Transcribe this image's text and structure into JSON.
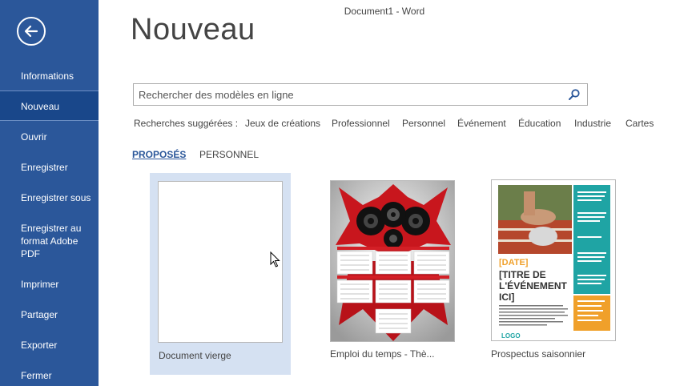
{
  "window": {
    "title": "Document1  -  Word"
  },
  "sidebar": {
    "back_icon": "back-arrow-icon",
    "items": [
      {
        "label": "Informations"
      },
      {
        "label": "Nouveau"
      },
      {
        "label": "Ouvrir"
      },
      {
        "label": "Enregistrer"
      },
      {
        "label": "Enregistrer sous"
      },
      {
        "label": "Enregistrer au format Adobe PDF"
      },
      {
        "label": "Imprimer"
      },
      {
        "label": "Partager"
      },
      {
        "label": "Exporter"
      },
      {
        "label": "Fermer"
      }
    ],
    "active_index": 1
  },
  "main": {
    "title": "Nouveau",
    "search": {
      "placeholder": "Rechercher des modèles en ligne",
      "value": ""
    },
    "suggested": {
      "label": "Recherches suggérées :",
      "items": [
        "Jeux de créations",
        "Professionnel",
        "Personnel",
        "Événement",
        "Éducation",
        "Industrie",
        "Cartes"
      ]
    },
    "tabs": [
      {
        "label": "PROPOSÉS",
        "active": true
      },
      {
        "label": "PERSONNEL",
        "active": false
      }
    ],
    "templates": [
      {
        "label": "Document vierge",
        "selected": true
      },
      {
        "label": "Emploi du temps - Thè...",
        "selected": false
      },
      {
        "label": "Prospectus saisonnier",
        "selected": false
      }
    ],
    "flyer": {
      "date": "[DATE]",
      "title_lines": [
        "[TITRE DE",
        "L'ÉVÉNEMENT",
        "ICI]"
      ],
      "logo": "LOGO"
    }
  },
  "colors": {
    "accent": "#2b579a",
    "selected_bg": "#d5e1f2",
    "teal": "#1fa4a4",
    "orange": "#f0a02a",
    "red": "#d31f26"
  }
}
